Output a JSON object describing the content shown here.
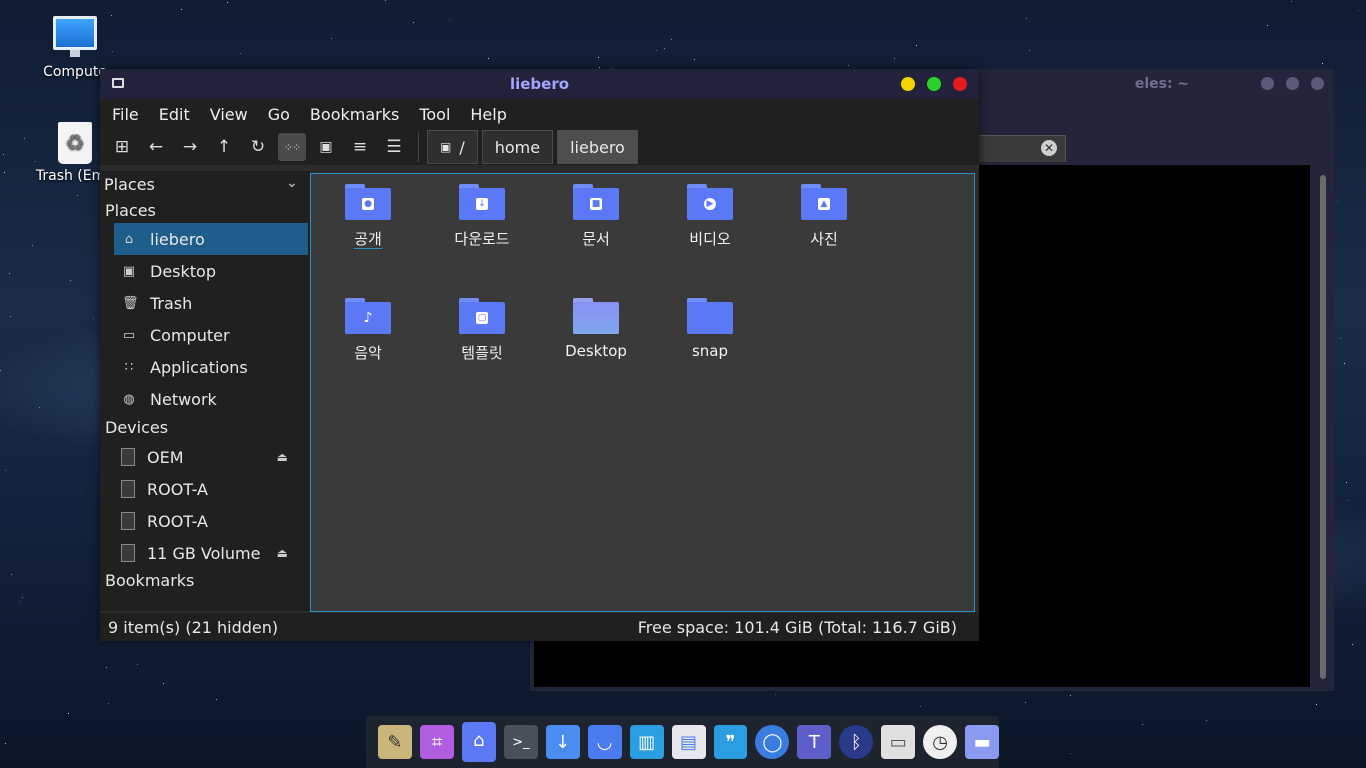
{
  "desktop": {
    "icons": [
      {
        "label": "Compute",
        "icon": "computer-icon"
      },
      {
        "label": "Trash (Emp",
        "icon": "trash-icon"
      }
    ]
  },
  "terminal": {
    "title_fragment": "eles: ~",
    "tab_close": "✕"
  },
  "file_manager": {
    "title": "liebero",
    "menu": [
      "File",
      "Edit",
      "View",
      "Go",
      "Bookmarks",
      "Tool",
      "Help"
    ],
    "breadcrumbs": [
      "/",
      "home",
      "liebero"
    ],
    "sidebar": {
      "header": "Places",
      "places_label": "Places",
      "places": [
        "liebero",
        "Desktop",
        "Trash",
        "Computer",
        "Applications",
        "Network"
      ],
      "devices_label": "Devices",
      "devices": [
        "OEM",
        "ROOT-A",
        "ROOT-A",
        "11 GB Volume"
      ],
      "bookmarks_label": "Bookmarks"
    },
    "files": [
      {
        "name": "공개",
        "badge": "person"
      },
      {
        "name": "다운로드",
        "badge": "download"
      },
      {
        "name": "문서",
        "badge": "document"
      },
      {
        "name": "비디오",
        "badge": "video"
      },
      {
        "name": "사진",
        "badge": "image"
      },
      {
        "name": "음악",
        "badge": "music"
      },
      {
        "name": "템플릿",
        "badge": "template"
      },
      {
        "name": "Desktop",
        "badge": "desktop"
      },
      {
        "name": "snap",
        "badge": "none"
      }
    ],
    "status_left": "9 item(s) (21 hidden)",
    "status_right": "Free space: 101.4 GiB (Total: 116.7 GiB)"
  },
  "colors": {
    "accent": "#5c79f5",
    "selection": "#1f5e8a",
    "title_text": "#a7a5ff",
    "btn_yellow": "#f4d400",
    "btn_green": "#2bd12b",
    "btn_red": "#e81a1a"
  }
}
